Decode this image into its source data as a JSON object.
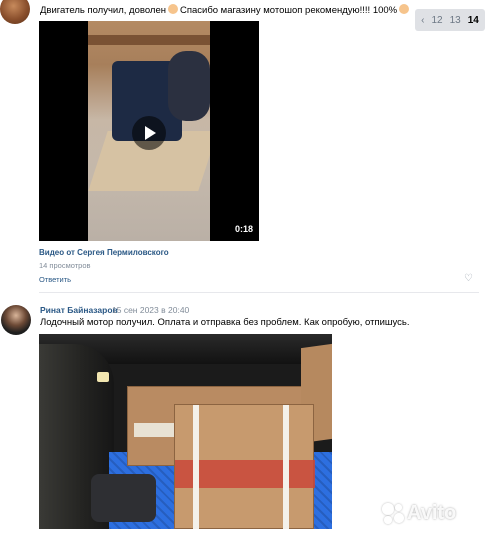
{
  "comments": [
    {
      "text_before": "Двигатель получил, доволен",
      "text_after": "Спасибо магазину мотошоп рекомендую!!!! 100%",
      "video": {
        "duration": "0:18",
        "title": "Видео от Сергея Пермиловского",
        "views": "14 просмотров"
      },
      "reply_label": "Ответить",
      "like_icon": "heart-icon"
    },
    {
      "author": "Ринат Байназаров",
      "date": "15 сен 2023 в 20:40",
      "text": "Лодочный мотор получил. Оплата и отправка без проблем. Как опробую, отпишусь."
    }
  ],
  "pagination": {
    "prev_icon": "chevron-left-icon",
    "pages": [
      "12",
      "13",
      "14"
    ],
    "current": "14"
  },
  "watermark": "Avito"
}
